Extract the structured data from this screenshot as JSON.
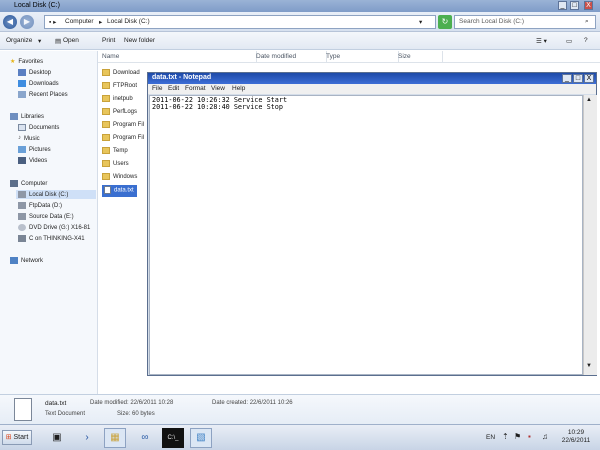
{
  "window": {
    "title": "Local Disk (C:)",
    "controls": {
      "minimize": "_",
      "maximize": "□",
      "close": "X"
    }
  },
  "address": {
    "back": "◀",
    "forward": "▶",
    "crumbs": [
      "Computer",
      "Local Disk (C:)"
    ],
    "search_placeholder": "Search Local Disk (C:)"
  },
  "toolbar": {
    "organize": "Organize",
    "open": "Open",
    "print": "Print",
    "new_folder": "New folder"
  },
  "columns": [
    "Name",
    "Date modified",
    "Type",
    "Size"
  ],
  "nav": {
    "favorites": "Favorites",
    "favorites_items": [
      "Desktop",
      "Downloads",
      "Recent Places"
    ],
    "libraries": "Libraries",
    "libraries_items": [
      "Documents",
      "Music",
      "Pictures",
      "Videos"
    ],
    "computer": "Computer",
    "computer_items": [
      "Local Disk (C:)",
      "FtpData (D:)",
      "Source Data (E:)",
      "DVD Drive (G:) X16-81",
      "C on THINKING-X41"
    ],
    "network": "Network"
  },
  "files": [
    "Download",
    "FTPRoot",
    "inetpub",
    "PerfLogs",
    "Program Fil",
    "Program Fil",
    "Temp",
    "Users",
    "Windows",
    "data.txt"
  ],
  "notepad": {
    "title": "data.txt - Notepad",
    "menu": [
      "File",
      "Edit",
      "Format",
      "View",
      "Help"
    ],
    "lines": [
      "2011-06-22 10:26:32 Service Start",
      "2011-06-22 10:28:40 Service Stop"
    ]
  },
  "details": {
    "name": "data.txt",
    "type": "Text Document",
    "modified": "Date modified: 22/6/2011 10:28",
    "size": "Size: 60 bytes",
    "created": "Date created: 22/6/2011 10:26"
  },
  "taskbar": {
    "start": "Start",
    "lang": "EN",
    "time": "10:29",
    "date": "22/6/2011"
  }
}
